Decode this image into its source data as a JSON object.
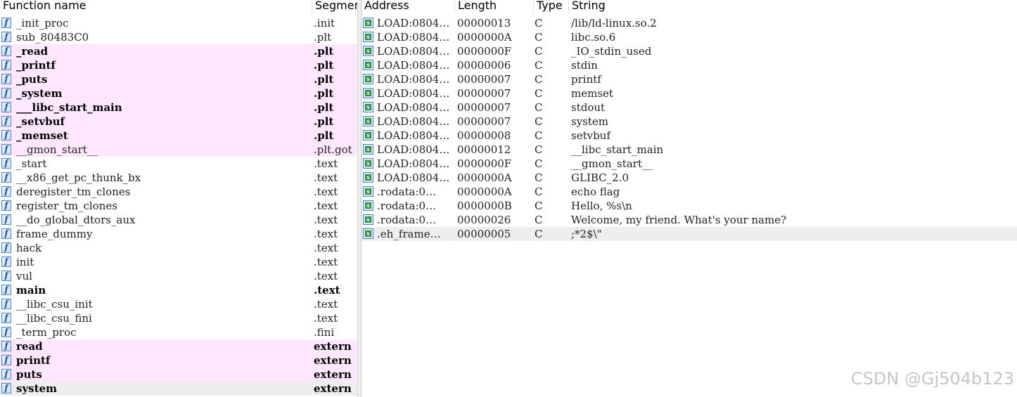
{
  "functions_view": {
    "columns": {
      "name": "Function name",
      "segment": "Segment"
    },
    "rows": [
      {
        "name": "_init_proc",
        "segment": ".init",
        "style": "normal"
      },
      {
        "name": "sub_80483C0",
        "segment": ".plt",
        "style": "normal"
      },
      {
        "name": "_read",
        "segment": ".plt",
        "style": "import-bold"
      },
      {
        "name": "_printf",
        "segment": ".plt",
        "style": "import-bold"
      },
      {
        "name": "_puts",
        "segment": ".plt",
        "style": "import-bold"
      },
      {
        "name": "_system",
        "segment": ".plt",
        "style": "import-bold"
      },
      {
        "name": "___libc_start_main",
        "segment": ".plt",
        "style": "import-bold"
      },
      {
        "name": "_setvbuf",
        "segment": ".plt",
        "style": "import-bold"
      },
      {
        "name": "_memset",
        "segment": ".plt",
        "style": "import-bold"
      },
      {
        "name": "__gmon_start__",
        "segment": ".plt.got",
        "style": "import"
      },
      {
        "name": "_start",
        "segment": ".text",
        "style": "normal"
      },
      {
        "name": "__x86_get_pc_thunk_bx",
        "segment": ".text",
        "style": "normal"
      },
      {
        "name": "deregister_tm_clones",
        "segment": ".text",
        "style": "normal"
      },
      {
        "name": "register_tm_clones",
        "segment": ".text",
        "style": "normal"
      },
      {
        "name": "__do_global_dtors_aux",
        "segment": ".text",
        "style": "normal"
      },
      {
        "name": "frame_dummy",
        "segment": ".text",
        "style": "normal"
      },
      {
        "name": "hack",
        "segment": ".text",
        "style": "normal"
      },
      {
        "name": "init",
        "segment": ".text",
        "style": "normal"
      },
      {
        "name": "vul",
        "segment": ".text",
        "style": "normal"
      },
      {
        "name": "main",
        "segment": ".text",
        "style": "bold"
      },
      {
        "name": "__libc_csu_init",
        "segment": ".text",
        "style": "normal"
      },
      {
        "name": "__libc_csu_fini",
        "segment": ".text",
        "style": "normal"
      },
      {
        "name": "_term_proc",
        "segment": ".fini",
        "style": "normal"
      },
      {
        "name": "read",
        "segment": "extern",
        "style": "import-bold"
      },
      {
        "name": "printf",
        "segment": "extern",
        "style": "import-bold"
      },
      {
        "name": "puts",
        "segment": "extern",
        "style": "import-bold"
      },
      {
        "name": "system",
        "segment": "extern",
        "style": "selected-bold"
      }
    ]
  },
  "strings_view": {
    "columns": {
      "address": "Address",
      "length": "Length",
      "type": "Type",
      "string": "String"
    },
    "rows": [
      {
        "address": "LOAD:0804…",
        "length": "00000013",
        "type": "C",
        "string": "/lib/ld-linux.so.2"
      },
      {
        "address": "LOAD:0804…",
        "length": "0000000A",
        "type": "C",
        "string": "libc.so.6"
      },
      {
        "address": "LOAD:0804…",
        "length": "0000000F",
        "type": "C",
        "string": "_IO_stdin_used"
      },
      {
        "address": "LOAD:0804…",
        "length": "00000006",
        "type": "C",
        "string": "stdin"
      },
      {
        "address": "LOAD:0804…",
        "length": "00000007",
        "type": "C",
        "string": "printf"
      },
      {
        "address": "LOAD:0804…",
        "length": "00000007",
        "type": "C",
        "string": "memset"
      },
      {
        "address": "LOAD:0804…",
        "length": "00000007",
        "type": "C",
        "string": "stdout"
      },
      {
        "address": "LOAD:0804…",
        "length": "00000007",
        "type": "C",
        "string": "system"
      },
      {
        "address": "LOAD:0804…",
        "length": "00000008",
        "type": "C",
        "string": "setvbuf"
      },
      {
        "address": "LOAD:0804…",
        "length": "00000012",
        "type": "C",
        "string": "__libc_start_main"
      },
      {
        "address": "LOAD:0804…",
        "length": "0000000F",
        "type": "C",
        "string": "__gmon_start__"
      },
      {
        "address": "LOAD:0804…",
        "length": "0000000A",
        "type": "C",
        "string": "GLIBC_2.0"
      },
      {
        "address": ".rodata:0…",
        "length": "0000000A",
        "type": "C",
        "string": "echo flag"
      },
      {
        "address": ".rodata:0…",
        "length": "0000000B",
        "type": "C",
        "string": "Hello, %s\\n"
      },
      {
        "address": ".rodata:0…",
        "length": "00000026",
        "type": "C",
        "string": "Welcome, my friend. What's your name?"
      },
      {
        "address": ".eh_frame…",
        "length": "00000005",
        "type": "C",
        "string": ";*2$\\\"",
        "selected": true
      }
    ]
  },
  "icons": {
    "function": "function-icon",
    "string": "string-icon",
    "function_glyph": "f",
    "string_glyph": "s"
  },
  "colors": {
    "import_row": "#ffe8ff",
    "selected_row": "#eeeeee",
    "icon_border": "#4a86c8"
  },
  "watermark": "CSDN @Gj504b123"
}
